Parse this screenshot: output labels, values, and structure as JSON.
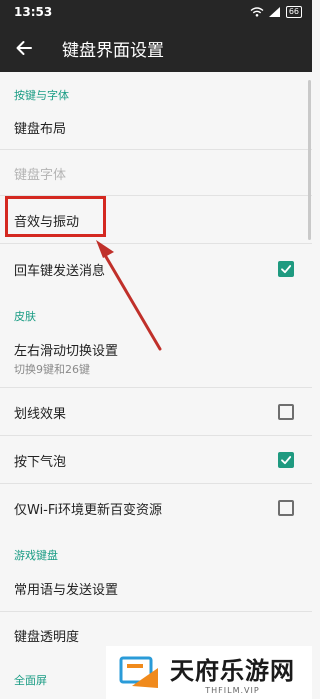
{
  "status_bar": {
    "time": "13:53",
    "battery": "66",
    "icons": [
      "wifi-icon",
      "signal-icon",
      "battery-icon"
    ]
  },
  "header": {
    "title": "键盘界面设置",
    "back_icon": "arrow-left-icon"
  },
  "sections": {
    "keys_fonts": "按键与字体",
    "skin": "皮肤",
    "game_keyboard": "游戏键盘",
    "fullscreen": "全面屏"
  },
  "items": {
    "keyboard_layout": "键盘布局",
    "keyboard_font": "键盘字体",
    "sound_vibration": "音效与振动",
    "enter_send": "回车键发送消息",
    "swipe_switch": "左右滑动切换设置",
    "swipe_switch_sub": "切换9键和26键",
    "swipe_effect": "划线效果",
    "press_bubble": "按下气泡",
    "wifi_update": "仅Wi-Fi环境更新百变资源",
    "common_phrases": "常用语与发送设置",
    "keyboard_opacity": "键盘透明度"
  },
  "checkboxes": {
    "enter_send": true,
    "swipe_effect": false,
    "press_bubble": true,
    "wifi_update": false
  },
  "watermark": {
    "name": "天府乐游网",
    "site": "THFILM.VIP"
  },
  "colors": {
    "accent": "#1a9c84",
    "checkbox_on": "#1f9a80",
    "annotation": "#d42820",
    "app_bar": "#262626"
  }
}
